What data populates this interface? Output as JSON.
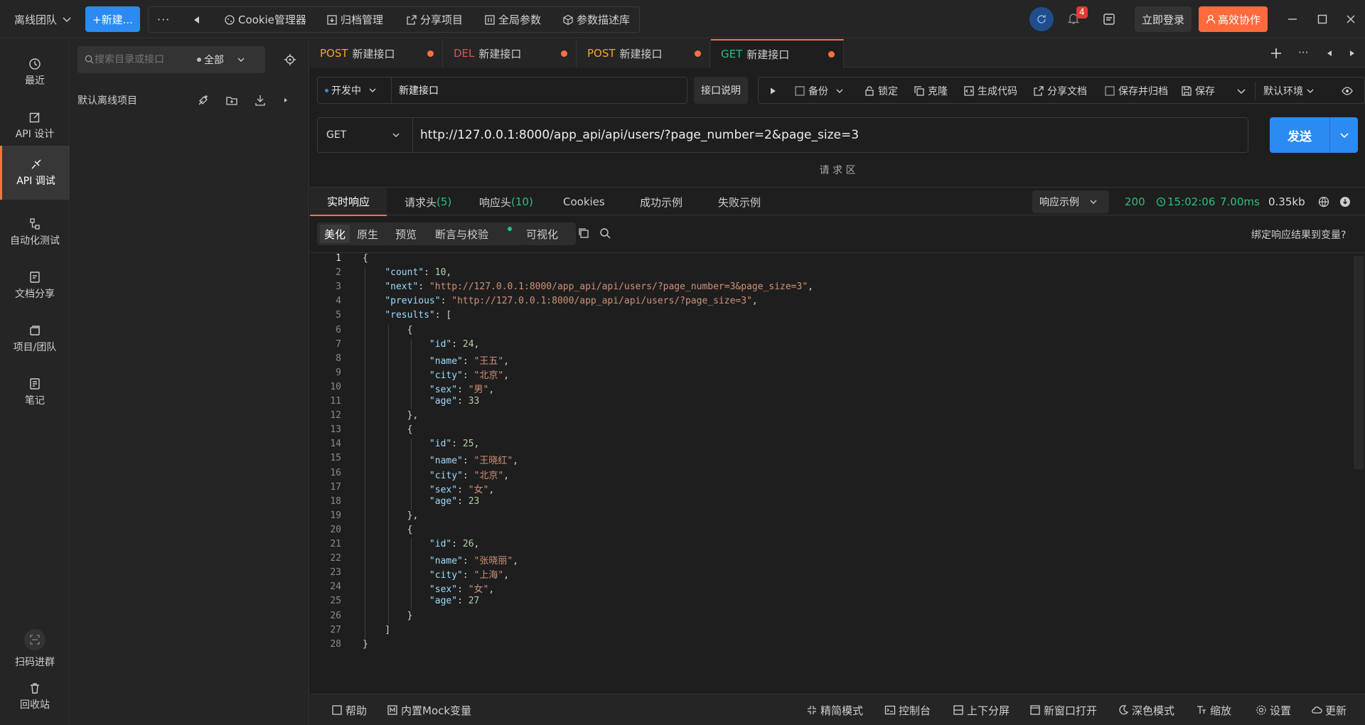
{
  "topbar": {
    "team": "离线团队",
    "new_button": "+新建...",
    "more": "···",
    "cookie": "Cookie管理器",
    "archive": "归档管理",
    "share_project": "分享项目",
    "global_params": "全局参数",
    "param_lib": "参数描述库",
    "notification_count": "4",
    "login": "立即登录",
    "collab": "高效协作"
  },
  "nav": {
    "recent": "最近",
    "api_design": "API 设计",
    "api_debug": "API 调试",
    "auto_test": "自动化测试",
    "doc_share": "文档分享",
    "project_team": "项目/团队",
    "notes": "笔记",
    "scan_group": "扫码进群",
    "recycle": "回收站"
  },
  "tree": {
    "search_placeholder": "搜索目录或接口",
    "filter": "全部",
    "project": "默认离线项目"
  },
  "tabs": [
    {
      "method": "POST",
      "name": "新建接口",
      "color": "#f5a623"
    },
    {
      "method": "DEL",
      "name": "新建接口",
      "color": "#e05252"
    },
    {
      "method": "POST",
      "name": "新建接口",
      "color": "#f5a623"
    },
    {
      "method": "GET",
      "name": "新建接口",
      "color": "#27c27c"
    }
  ],
  "toolbar": {
    "status": "开发中",
    "api_name": "新建接口",
    "api_desc": "接口说明",
    "backup": "备份",
    "lock": "锁定",
    "clone": "克隆",
    "gen_code": "生成代码",
    "share_doc": "分享文档",
    "save_archive": "保存并归档",
    "save": "保存",
    "env": "默认环境"
  },
  "request": {
    "method": "GET",
    "url": "http://127.0.0.1:8000/app_api/api/users/?page_number=2&page_size=3",
    "send": "发送",
    "area_label": "请 求 区"
  },
  "response": {
    "tabs": [
      "实时响应",
      "请求头",
      "响应头",
      "Cookies",
      "成功示例",
      "失败示例"
    ],
    "req_headers_count": "(5)",
    "resp_headers_count": "(10)",
    "example_select": "响应示例",
    "status": "200",
    "time": "15:02:06",
    "duration": "7.00ms",
    "size": "0.35kb",
    "sub_tabs": [
      "美化",
      "原生",
      "预览",
      "断言与校验",
      "可视化"
    ],
    "bind_link": "绑定响应结果到变量?"
  },
  "code_lines": [
    "{",
    "    \"count\": 10,",
    "    \"next\": \"http://127.0.0.1:8000/app_api/api/users/?page_number=3&page_size=3\",",
    "    \"previous\": \"http://127.0.0.1:8000/app_api/api/users/?page_size=3\",",
    "    \"results\": [",
    "        {",
    "            \"id\": 24,",
    "            \"name\": \"王五\",",
    "            \"city\": \"北京\",",
    "            \"sex\": \"男\",",
    "            \"age\": 33",
    "        },",
    "        {",
    "            \"id\": 25,",
    "            \"name\": \"王晓红\",",
    "            \"city\": \"北京\",",
    "            \"sex\": \"女\",",
    "            \"age\": 23",
    "        },",
    "        {",
    "            \"id\": 26,",
    "            \"name\": \"张晓丽\",",
    "            \"city\": \"上海\",",
    "            \"sex\": \"女\",",
    "            \"age\": 27",
    "        }",
    "    ]",
    "}"
  ],
  "footer": {
    "help": "帮助",
    "mock": "内置Mock变量",
    "simple": "精简模式",
    "console": "控制台",
    "split": "上下分屏",
    "new_window": "新窗口打开",
    "dark": "深色模式",
    "zoom": "缩放",
    "settings": "设置",
    "update": "更新"
  },
  "colors": {
    "accent": "#ff7043",
    "primary": "#2b8bf2",
    "success": "#27c27c"
  }
}
